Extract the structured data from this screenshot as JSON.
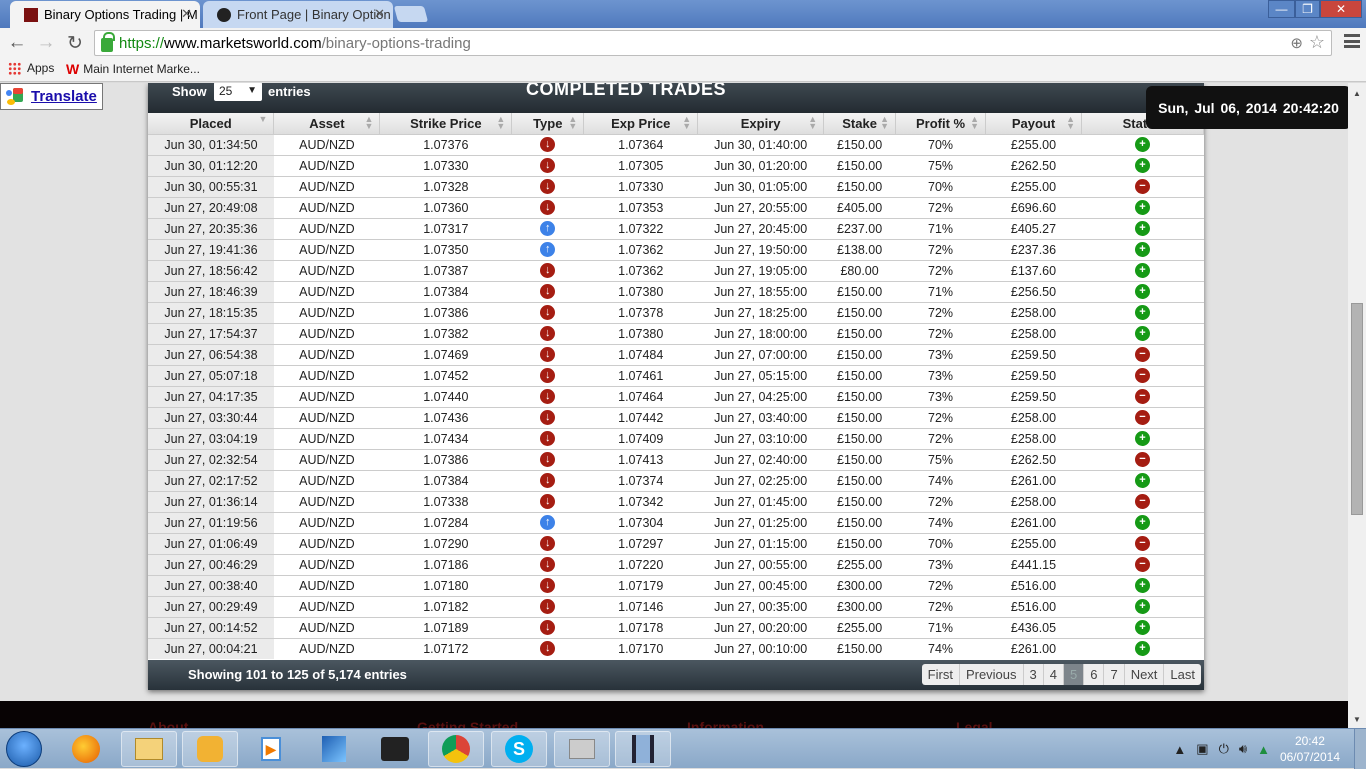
{
  "browser": {
    "tabs": [
      {
        "label": "Binary Options Trading | M",
        "active": true
      },
      {
        "label": "Front Page | Binary Option",
        "active": false
      }
    ],
    "window_controls": {
      "minimize": "—",
      "restore": "❐",
      "close": "✕"
    },
    "nav": {
      "back": "←",
      "forward": "→",
      "reload": "↻"
    },
    "url": {
      "scheme": "https://",
      "host": "www.marketsworld.com",
      "path": "/binary-options-trading"
    },
    "bookmarks": [
      {
        "label": "Apps"
      },
      {
        "label": "Main Internet Marke..."
      }
    ]
  },
  "translate": {
    "label": "Translate"
  },
  "panel": {
    "show_label": "Show",
    "entries_value": "25",
    "entries_label": "entries",
    "title": "COMPLETED TRADES",
    "clock": "Sun, Jul 06, 2014   20:42:20",
    "columns": [
      "Placed",
      "Asset",
      "Strike Price",
      "Type",
      "Exp Price",
      "Expiry",
      "Stake",
      "Profit %",
      "Payout",
      "Status"
    ],
    "rows": [
      {
        "placed": "Jun 30, 01:34:50",
        "asset": "AUD/NZD",
        "strike": "1.07376",
        "type": "down",
        "exp_price": "1.07364",
        "expiry": "Jun 30, 01:40:00",
        "stake": "£150.00",
        "profit": "70%",
        "payout": "£255.00",
        "status": "win"
      },
      {
        "placed": "Jun 30, 01:12:20",
        "asset": "AUD/NZD",
        "strike": "1.07330",
        "type": "down",
        "exp_price": "1.07305",
        "expiry": "Jun 30, 01:20:00",
        "stake": "£150.00",
        "profit": "75%",
        "payout": "£262.50",
        "status": "win"
      },
      {
        "placed": "Jun 30, 00:55:31",
        "asset": "AUD/NZD",
        "strike": "1.07328",
        "type": "down",
        "exp_price": "1.07330",
        "expiry": "Jun 30, 01:05:00",
        "stake": "£150.00",
        "profit": "70%",
        "payout": "£255.00",
        "status": "loss"
      },
      {
        "placed": "Jun 27, 20:49:08",
        "asset": "AUD/NZD",
        "strike": "1.07360",
        "type": "down",
        "exp_price": "1.07353",
        "expiry": "Jun 27, 20:55:00",
        "stake": "£405.00",
        "profit": "72%",
        "payout": "£696.60",
        "status": "win"
      },
      {
        "placed": "Jun 27, 20:35:36",
        "asset": "AUD/NZD",
        "strike": "1.07317",
        "type": "up",
        "exp_price": "1.07322",
        "expiry": "Jun 27, 20:45:00",
        "stake": "£237.00",
        "profit": "71%",
        "payout": "£405.27",
        "status": "win"
      },
      {
        "placed": "Jun 27, 19:41:36",
        "asset": "AUD/NZD",
        "strike": "1.07350",
        "type": "up",
        "exp_price": "1.07362",
        "expiry": "Jun 27, 19:50:00",
        "stake": "£138.00",
        "profit": "72%",
        "payout": "£237.36",
        "status": "win"
      },
      {
        "placed": "Jun 27, 18:56:42",
        "asset": "AUD/NZD",
        "strike": "1.07387",
        "type": "down",
        "exp_price": "1.07362",
        "expiry": "Jun 27, 19:05:00",
        "stake": "£80.00",
        "profit": "72%",
        "payout": "£137.60",
        "status": "win"
      },
      {
        "placed": "Jun 27, 18:46:39",
        "asset": "AUD/NZD",
        "strike": "1.07384",
        "type": "down",
        "exp_price": "1.07380",
        "expiry": "Jun 27, 18:55:00",
        "stake": "£150.00",
        "profit": "71%",
        "payout": "£256.50",
        "status": "win"
      },
      {
        "placed": "Jun 27, 18:15:35",
        "asset": "AUD/NZD",
        "strike": "1.07386",
        "type": "down",
        "exp_price": "1.07378",
        "expiry": "Jun 27, 18:25:00",
        "stake": "£150.00",
        "profit": "72%",
        "payout": "£258.00",
        "status": "win"
      },
      {
        "placed": "Jun 27, 17:54:37",
        "asset": "AUD/NZD",
        "strike": "1.07382",
        "type": "down",
        "exp_price": "1.07380",
        "expiry": "Jun 27, 18:00:00",
        "stake": "£150.00",
        "profit": "72%",
        "payout": "£258.00",
        "status": "win"
      },
      {
        "placed": "Jun 27, 06:54:38",
        "asset": "AUD/NZD",
        "strike": "1.07469",
        "type": "down",
        "exp_price": "1.07484",
        "expiry": "Jun 27, 07:00:00",
        "stake": "£150.00",
        "profit": "73%",
        "payout": "£259.50",
        "status": "loss"
      },
      {
        "placed": "Jun 27, 05:07:18",
        "asset": "AUD/NZD",
        "strike": "1.07452",
        "type": "down",
        "exp_price": "1.07461",
        "expiry": "Jun 27, 05:15:00",
        "stake": "£150.00",
        "profit": "73%",
        "payout": "£259.50",
        "status": "loss"
      },
      {
        "placed": "Jun 27, 04:17:35",
        "asset": "AUD/NZD",
        "strike": "1.07440",
        "type": "down",
        "exp_price": "1.07464",
        "expiry": "Jun 27, 04:25:00",
        "stake": "£150.00",
        "profit": "73%",
        "payout": "£259.50",
        "status": "loss"
      },
      {
        "placed": "Jun 27, 03:30:44",
        "asset": "AUD/NZD",
        "strike": "1.07436",
        "type": "down",
        "exp_price": "1.07442",
        "expiry": "Jun 27, 03:40:00",
        "stake": "£150.00",
        "profit": "72%",
        "payout": "£258.00",
        "status": "loss"
      },
      {
        "placed": "Jun 27, 03:04:19",
        "asset": "AUD/NZD",
        "strike": "1.07434",
        "type": "down",
        "exp_price": "1.07409",
        "expiry": "Jun 27, 03:10:00",
        "stake": "£150.00",
        "profit": "72%",
        "payout": "£258.00",
        "status": "win"
      },
      {
        "placed": "Jun 27, 02:32:54",
        "asset": "AUD/NZD",
        "strike": "1.07386",
        "type": "down",
        "exp_price": "1.07413",
        "expiry": "Jun 27, 02:40:00",
        "stake": "£150.00",
        "profit": "75%",
        "payout": "£262.50",
        "status": "loss"
      },
      {
        "placed": "Jun 27, 02:17:52",
        "asset": "AUD/NZD",
        "strike": "1.07384",
        "type": "down",
        "exp_price": "1.07374",
        "expiry": "Jun 27, 02:25:00",
        "stake": "£150.00",
        "profit": "74%",
        "payout": "£261.00",
        "status": "win"
      },
      {
        "placed": "Jun 27, 01:36:14",
        "asset": "AUD/NZD",
        "strike": "1.07338",
        "type": "down",
        "exp_price": "1.07342",
        "expiry": "Jun 27, 01:45:00",
        "stake": "£150.00",
        "profit": "72%",
        "payout": "£258.00",
        "status": "loss"
      },
      {
        "placed": "Jun 27, 01:19:56",
        "asset": "AUD/NZD",
        "strike": "1.07284",
        "type": "up",
        "exp_price": "1.07304",
        "expiry": "Jun 27, 01:25:00",
        "stake": "£150.00",
        "profit": "74%",
        "payout": "£261.00",
        "status": "win"
      },
      {
        "placed": "Jun 27, 01:06:49",
        "asset": "AUD/NZD",
        "strike": "1.07290",
        "type": "down",
        "exp_price": "1.07297",
        "expiry": "Jun 27, 01:15:00",
        "stake": "£150.00",
        "profit": "70%",
        "payout": "£255.00",
        "status": "loss"
      },
      {
        "placed": "Jun 27, 00:46:29",
        "asset": "AUD/NZD",
        "strike": "1.07186",
        "type": "down",
        "exp_price": "1.07220",
        "expiry": "Jun 27, 00:55:00",
        "stake": "£255.00",
        "profit": "73%",
        "payout": "£441.15",
        "status": "loss"
      },
      {
        "placed": "Jun 27, 00:38:40",
        "asset": "AUD/NZD",
        "strike": "1.07180",
        "type": "down",
        "exp_price": "1.07179",
        "expiry": "Jun 27, 00:45:00",
        "stake": "£300.00",
        "profit": "72%",
        "payout": "£516.00",
        "status": "win"
      },
      {
        "placed": "Jun 27, 00:29:49",
        "asset": "AUD/NZD",
        "strike": "1.07182",
        "type": "down",
        "exp_price": "1.07146",
        "expiry": "Jun 27, 00:35:00",
        "stake": "£300.00",
        "profit": "72%",
        "payout": "£516.00",
        "status": "win"
      },
      {
        "placed": "Jun 27, 00:14:52",
        "asset": "AUD/NZD",
        "strike": "1.07189",
        "type": "down",
        "exp_price": "1.07178",
        "expiry": "Jun 27, 00:20:00",
        "stake": "£255.00",
        "profit": "71%",
        "payout": "£436.05",
        "status": "win"
      },
      {
        "placed": "Jun 27, 00:04:21",
        "asset": "AUD/NZD",
        "strike": "1.07172",
        "type": "down",
        "exp_price": "1.07170",
        "expiry": "Jun 27, 00:10:00",
        "stake": "£150.00",
        "profit": "74%",
        "payout": "£261.00",
        "status": "win"
      }
    ],
    "info": "Showing 101 to 125 of 5,174 entries",
    "pagination": [
      {
        "label": "First",
        "current": false
      },
      {
        "label": "Previous",
        "current": false
      },
      {
        "label": "3",
        "current": false
      },
      {
        "label": "4",
        "current": false
      },
      {
        "label": "5",
        "current": true
      },
      {
        "label": "6",
        "current": false
      },
      {
        "label": "7",
        "current": false
      },
      {
        "label": "Next",
        "current": false
      },
      {
        "label": "Last",
        "current": false
      }
    ]
  },
  "footer": {
    "headings": [
      "About",
      "Getting Started",
      "Information",
      "Legal"
    ]
  },
  "taskbar": {
    "apps": [
      "firefox",
      "explorer",
      "control-panel",
      "media-player",
      "editor",
      "video-camera",
      "chrome",
      "skype",
      "device-manager",
      "movie-maker"
    ],
    "clock_time": "20:42",
    "clock_date": "06/07/2014"
  },
  "colors": {
    "up": "#3d82e8",
    "down": "#a51d12",
    "win": "#169a16",
    "loss": "#a51d12"
  }
}
